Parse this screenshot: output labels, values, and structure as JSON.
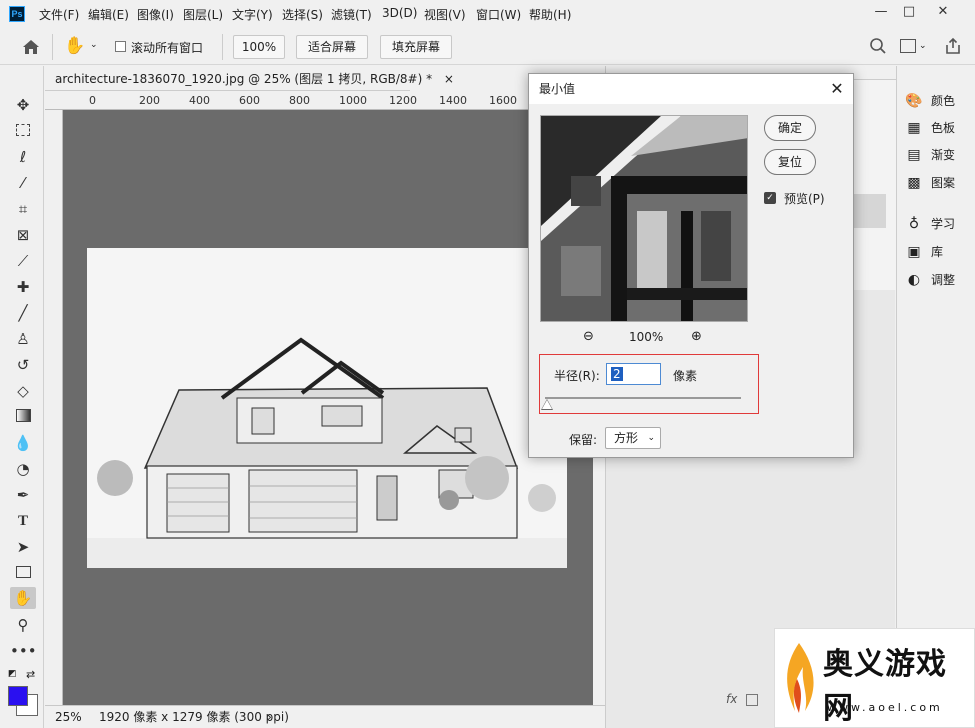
{
  "app": {
    "logo": "Ps"
  },
  "menu": [
    "文件(F)",
    "编辑(E)",
    "图像(I)",
    "图层(L)",
    "文字(Y)",
    "选择(S)",
    "滤镜(T)",
    "3D(D)",
    "视图(V)",
    "窗口(W)",
    "帮助(H)"
  ],
  "window_controls": {
    "minimize": "—",
    "maximize": "□",
    "close": "✕"
  },
  "options_bar": {
    "scroll_all_label": "滚动所有窗口",
    "zoom_value": "100%",
    "fit_screen": "适合屏幕",
    "fill_screen": "填充屏幕"
  },
  "document": {
    "tab_title": "architecture-1836070_1920.jpg @ 25% (图层 1 拷贝, RGB/8#) *",
    "tab_close": "×",
    "ruler_labels": [
      "0",
      "200",
      "400",
      "600",
      "800",
      "1000",
      "1200",
      "1400",
      "1600"
    ],
    "status_zoom": "25%",
    "status_info": "1920 像素 x 1279 像素 (300 ppi)",
    "status_arrow": "›"
  },
  "tools": [
    "move-icon",
    "marquee-icon",
    "lasso-icon",
    "magic-wand-icon",
    "crop-icon",
    "frame-icon",
    "eyedropper-icon",
    "healing-icon",
    "brush-icon",
    "stamp-icon",
    "history-brush-icon",
    "eraser-icon",
    "gradient-icon",
    "blur-icon",
    "dodge-icon",
    "pen-icon",
    "type-icon",
    "path-select-icon",
    "rectangle-icon",
    "hand-icon",
    "zoom-icon",
    "more-icon"
  ],
  "colors": {
    "foreground": "#2a10f0",
    "background": "#ffffff",
    "canvas": "#6b6b6b",
    "highlight": "#e03a3a"
  },
  "right_panel": {
    "items": [
      {
        "icon": "palette-icon",
        "label": "颜色"
      },
      {
        "icon": "swatches-icon",
        "label": "色板"
      },
      {
        "icon": "gradient-panel-icon",
        "label": "渐变"
      },
      {
        "icon": "pattern-icon",
        "label": "图案"
      },
      {
        "icon": "bulb-icon",
        "label": "学习"
      },
      {
        "icon": "library-icon",
        "label": "库"
      },
      {
        "icon": "adjust-icon",
        "label": "调整"
      }
    ]
  },
  "dialog": {
    "title": "最小值",
    "ok": "确定",
    "reset": "复位",
    "preview_label": "预览(P)",
    "preview_checked": true,
    "zoom_value": "100%",
    "radius_label": "半径(R):",
    "radius_value": "2",
    "radius_unit": "像素",
    "radius_slider_fraction": 0.0,
    "preserve_label": "保留:",
    "preserve_value": "方形"
  },
  "watermark": {
    "text": "奥义游戏网",
    "url": "www.aoel.com"
  }
}
